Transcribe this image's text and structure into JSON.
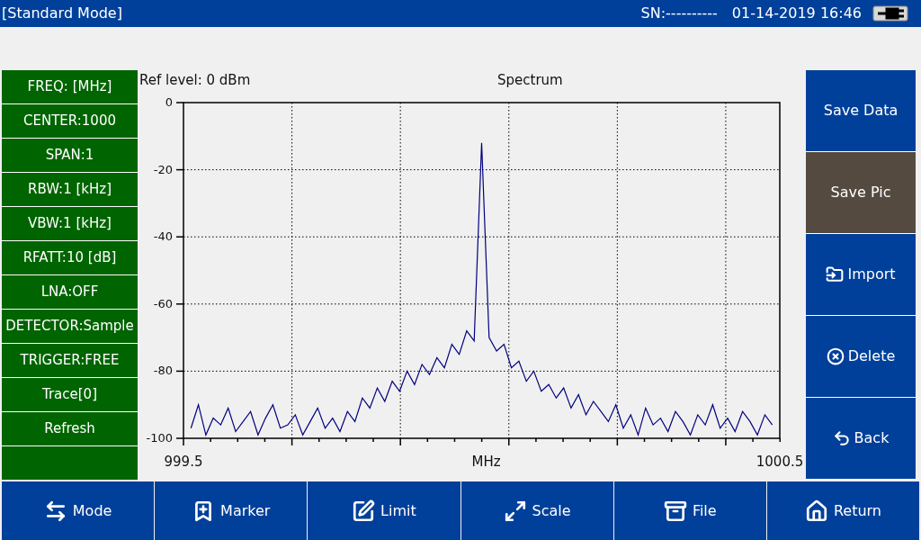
{
  "header": {
    "mode": "[Standard Mode]",
    "serial": "SN:----------",
    "datetime": "01-14-2019 16:46"
  },
  "left_menu": [
    {
      "label": "FREQ: [MHz]"
    },
    {
      "label": "CENTER:1000"
    },
    {
      "label": "SPAN:1"
    },
    {
      "label": "RBW:1 [kHz]"
    },
    {
      "label": "VBW:1 [kHz]"
    },
    {
      "label": "RFATT:10 [dB]"
    },
    {
      "label": "LNA:OFF"
    },
    {
      "label": "DETECTOR:Sample"
    },
    {
      "label": "TRIGGER:FREE"
    },
    {
      "label": "Trace[0]"
    },
    {
      "label": "Refresh"
    }
  ],
  "ref_level": "Ref level: 0 dBm",
  "chart": {
    "chart_data": {
      "type": "line",
      "title": "Spectrum",
      "xlabel": "MHz",
      "xlim": [
        999.5,
        1000.5
      ],
      "ylim": [
        -100,
        0
      ],
      "xticks": [
        {
          "value": 999.5,
          "label": "999.5"
        },
        {
          "value": 1000.5,
          "label": "1000.5"
        }
      ],
      "yticks": [
        {
          "value": 0,
          "label": "0"
        },
        {
          "value": -20,
          "label": "-20"
        },
        {
          "value": -40,
          "label": "-40"
        },
        {
          "value": -60,
          "label": "-60"
        },
        {
          "value": -80,
          "label": "-80"
        },
        {
          "value": -100,
          "label": "-100"
        }
      ],
      "grid": true,
      "x": [
        999.5125,
        999.525,
        999.5375,
        999.55,
        999.5625,
        999.575,
        999.5875,
        999.6,
        999.6125,
        999.625,
        999.6375,
        999.65,
        999.6625,
        999.675,
        999.6875,
        999.7,
        999.7125,
        999.725,
        999.7375,
        999.75,
        999.7625,
        999.775,
        999.7875,
        999.8,
        999.8125,
        999.825,
        999.8375,
        999.85,
        999.8625,
        999.875,
        999.8875,
        999.9,
        999.9125,
        999.925,
        999.9375,
        999.95,
        999.9625,
        999.975,
        999.9875,
        1000.0,
        1000.0125,
        1000.025,
        1000.0375,
        1000.05,
        1000.0625,
        1000.075,
        1000.0875,
        1000.1,
        1000.1125,
        1000.125,
        1000.1375,
        1000.15,
        1000.1625,
        1000.175,
        1000.1875,
        1000.2,
        1000.2125,
        1000.225,
        1000.2375,
        1000.25,
        1000.2625,
        1000.275,
        1000.2875,
        1000.3,
        1000.3125,
        1000.325,
        1000.3375,
        1000.35,
        1000.3625,
        1000.375,
        1000.3875,
        1000.4,
        1000.4125,
        1000.425,
        1000.4375,
        1000.45,
        1000.4625,
        1000.475,
        1000.4875
      ],
      "series": [
        {
          "color": "#000080",
          "values": [
            -97,
            -90,
            -99,
            -94,
            -96,
            -91,
            -98,
            -95,
            -92,
            -99,
            -94,
            -90,
            -97,
            -96,
            -93,
            -99,
            -95,
            -91,
            -97,
            -94,
            -98,
            -92,
            -95,
            -88,
            -91,
            -85,
            -89,
            -83,
            -86,
            -80,
            -84,
            -78,
            -81,
            -76,
            -79,
            -72,
            -75,
            -68,
            -71,
            -12,
            -70,
            -74,
            -72,
            -79,
            -77,
            -83,
            -80,
            -86,
            -84,
            -88,
            -85,
            -91,
            -87,
            -93,
            -89,
            -92,
            -95,
            -90,
            -97,
            -93,
            -99,
            -91,
            -96,
            -94,
            -98,
            -92,
            -95,
            -99,
            -93,
            -96,
            -90,
            -97,
            -94,
            -98,
            -92,
            -95,
            -99,
            -93,
            -96
          ]
        }
      ]
    }
  },
  "right_menu": [
    {
      "label": "Save Data",
      "selected": false
    },
    {
      "label": "Save Pic",
      "selected": true
    },
    {
      "label": "Import",
      "selected": false
    },
    {
      "label": "Delete",
      "selected": false
    },
    {
      "label": "Back",
      "selected": false
    }
  ],
  "bottom_bar": [
    {
      "label": "Mode"
    },
    {
      "label": "Marker"
    },
    {
      "label": "Limit"
    },
    {
      "label": "Scale"
    },
    {
      "label": "File"
    },
    {
      "label": "Return"
    }
  ]
}
